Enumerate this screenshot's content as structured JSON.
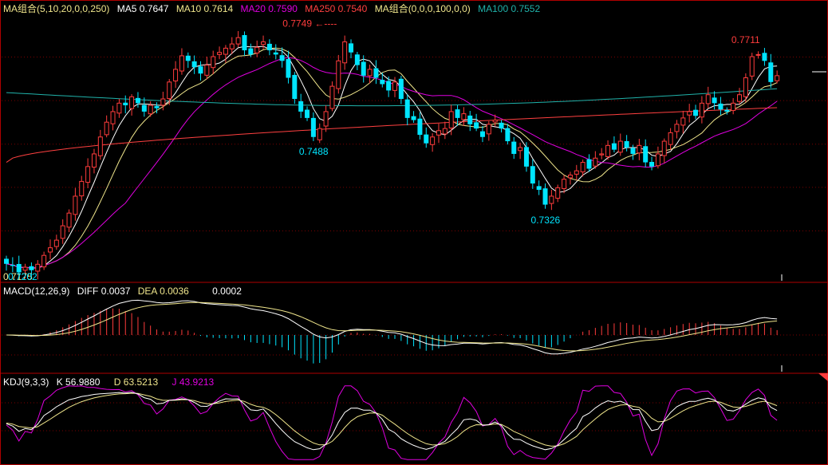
{
  "colors": {
    "background": "#000000",
    "up": "#ff3c3c",
    "down": "#00e5ff",
    "frame": "#b00000",
    "grid": "#7a0000",
    "ma5": "#ffffff",
    "ma10": "#f0e68c",
    "ma20": "#e000e0",
    "ma250": "#ff4040",
    "ma100": "#20b2aa",
    "diff": "#ffffff",
    "dea": "#f0e68c",
    "k": "#ffffff",
    "d": "#f0e68c",
    "j": "#e000e0"
  },
  "main_legend": {
    "group": "MA组合(5,10,20,0,0,250)",
    "ma5": "MA5 0.7647",
    "ma10": "MA10 0.7614",
    "ma20": "MA20 0.7590",
    "ma250": "MA250 0.7540",
    "group2": "MA组合(0,0,0,100,0,0)",
    "ma100": "MA100 0.7552"
  },
  "macd_legend": {
    "name": "MACD(12,26,9)",
    "diff": "DIFF  0.0037",
    "dea": "DEA  0.0036",
    "macd": "0.0002"
  },
  "kdj_legend": {
    "name": "KDJ(9,3,3)",
    "k": "K  56.9880",
    "d": "D  63.5213",
    "j": "J  43.9213"
  },
  "chart_data": [
    {
      "type": "candlestick",
      "ylim": [
        0.716,
        0.779
      ],
      "y_gridlines": [
        0.7689,
        0.7586,
        0.7483,
        0.7381,
        0.7278
      ],
      "annotations": [
        {
          "text": "0.7749",
          "index": 53,
          "value": 0.7749,
          "arrow": "←----"
        },
        {
          "text": "0.7488",
          "index": 49,
          "value": 0.7488
        },
        {
          "text": "0.7326",
          "index": 86,
          "value": 0.7326
        },
        {
          "text": "0.7711",
          "index": 118,
          "value": 0.7711
        },
        {
          "text": "0.7175",
          "index": 1,
          "value": 0.7175
        },
        {
          "text": "0.7202",
          "index": 3,
          "value": 0.7202
        }
      ],
      "closes": [
        0.72,
        0.7195,
        0.718,
        0.7192,
        0.7185,
        0.7199,
        0.722,
        0.7238,
        0.7256,
        0.729,
        0.732,
        0.736,
        0.7395,
        0.743,
        0.746,
        0.75,
        0.7535,
        0.756,
        0.758,
        0.7575,
        0.7595,
        0.758,
        0.756,
        0.7575,
        0.7568,
        0.759,
        0.763,
        0.766,
        0.7692,
        0.768,
        0.7665,
        0.765,
        0.767,
        0.769,
        0.77,
        0.771,
        0.772,
        0.7735,
        0.7705,
        0.7695,
        0.7712,
        0.7725,
        0.7705,
        0.7695,
        0.768,
        0.764,
        0.759,
        0.756,
        0.7545,
        0.75,
        0.752,
        0.756,
        0.762,
        0.768,
        0.7725,
        0.77,
        0.767,
        0.7645,
        0.766,
        0.764,
        0.7625,
        0.761,
        0.763,
        0.759,
        0.7545,
        0.754,
        0.7505,
        0.7485,
        0.75,
        0.7515,
        0.752,
        0.756,
        0.7545,
        0.7555,
        0.753,
        0.752,
        0.75,
        0.753,
        0.754,
        0.752,
        0.749,
        0.746,
        0.7475,
        0.743,
        0.739,
        0.7375,
        0.734,
        0.736,
        0.738,
        0.74,
        0.741,
        0.742,
        0.744,
        0.7425,
        0.745,
        0.746,
        0.748,
        0.747,
        0.749,
        0.7475,
        0.746,
        0.748,
        0.744,
        0.743,
        0.746,
        0.749,
        0.751,
        0.753,
        0.7545,
        0.756,
        0.755,
        0.758,
        0.76,
        0.758,
        0.7565,
        0.756,
        0.758,
        0.76,
        0.764,
        0.769,
        0.7695,
        0.768,
        0.763,
        0.7645
      ],
      "series": [
        {
          "name": "MA5",
          "value": 0.7647
        },
        {
          "name": "MA10",
          "value": 0.7614
        },
        {
          "name": "MA20",
          "value": 0.759
        },
        {
          "name": "MA250",
          "value": 0.754
        },
        {
          "name": "MA100",
          "value": 0.7552
        }
      ]
    },
    {
      "type": "bar",
      "series": [
        {
          "name": "DIFF",
          "value": 0.0037
        },
        {
          "name": "DEA",
          "value": 0.0036
        },
        {
          "name": "MACD",
          "value": 0.0002
        }
      ]
    },
    {
      "type": "line",
      "series": [
        {
          "name": "K",
          "value": 56.988
        },
        {
          "name": "D",
          "value": 63.5213
        },
        {
          "name": "J",
          "value": 43.9213
        }
      ]
    }
  ]
}
